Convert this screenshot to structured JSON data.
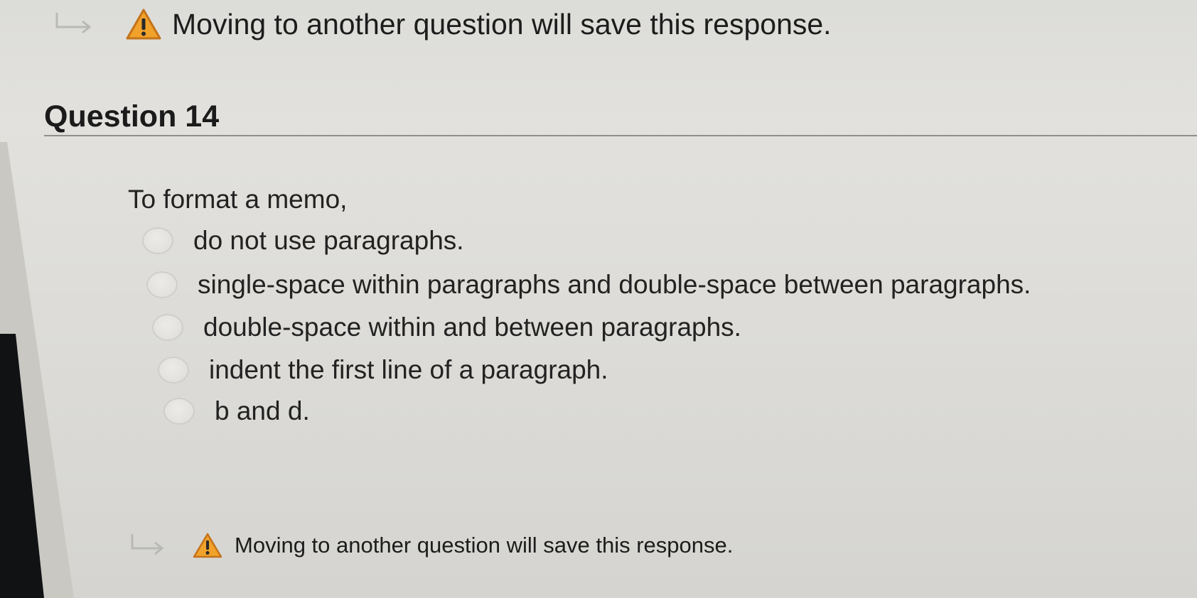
{
  "top_notice": {
    "text": "Moving to another question will save this response.",
    "arrow_icon": "return-arrow-icon",
    "warning_icon": "warning-icon"
  },
  "question": {
    "header": "Question 14",
    "prompt": "To format a memo,",
    "options": [
      {
        "label": "do not use paragraphs.",
        "selected": false
      },
      {
        "label": "single-space within paragraphs and double-space between paragraphs.",
        "selected": false
      },
      {
        "label": "double-space within and between paragraphs.",
        "selected": false
      },
      {
        "label": "indent the first line of a paragraph.",
        "selected": false
      },
      {
        "label": "b and d.",
        "selected": false
      }
    ]
  },
  "bottom_notice": {
    "text": "Moving to another question will save this response.",
    "arrow_icon": "return-arrow-icon",
    "warning_icon": "warning-icon"
  },
  "colors": {
    "warning_fill": "#f0a22a",
    "warning_stroke": "#c4731a",
    "arrow": "#b9b9b6",
    "rule": "#8e8e8c",
    "text": "#1f1f1f"
  }
}
